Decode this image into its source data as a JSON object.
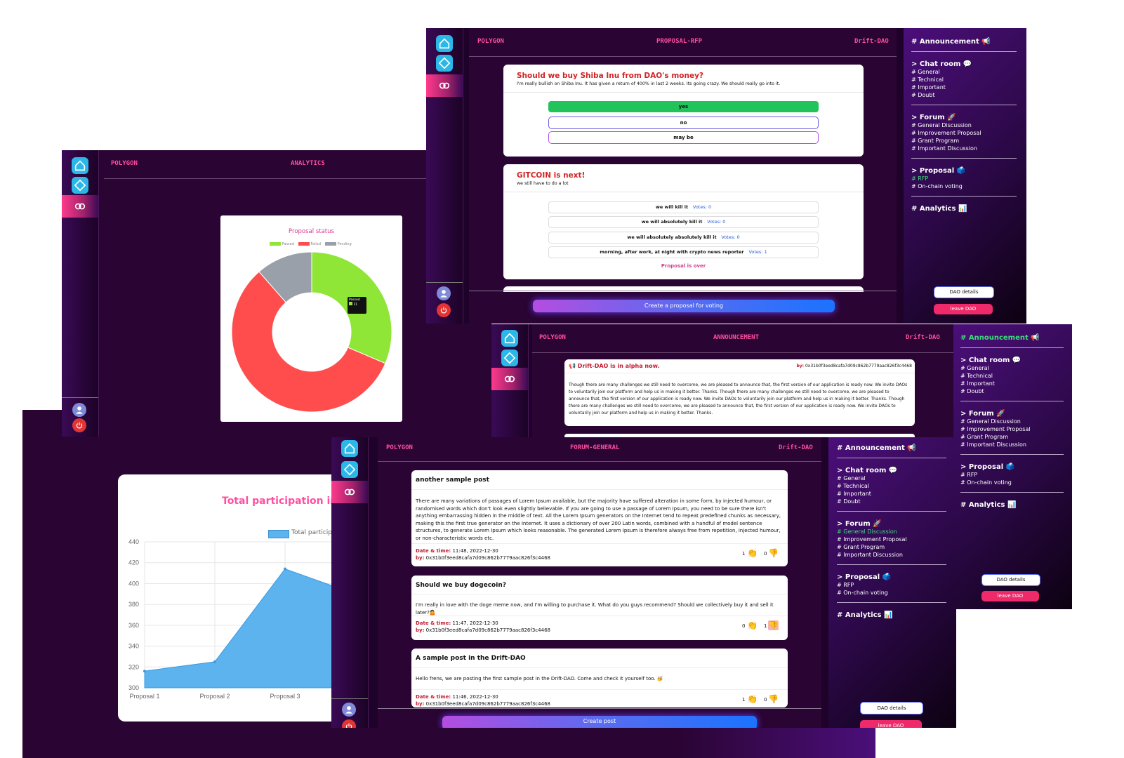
{
  "nav_common": {
    "left": "POLYGON",
    "right": "Drift-DAO"
  },
  "analytics": {
    "center": "ANALYTICS",
    "chart": {
      "title": "Proposal status",
      "tooltip_label": "Passed",
      "tooltip_value": "11"
    }
  },
  "participation": {
    "title": "Total participation in d",
    "legend": "Total participat"
  },
  "rfp": {
    "center": "PROPOSAL-RFP",
    "card1": {
      "title": "Should we buy Shiba Inu from DAO's money?",
      "desc": "I'm really bullish on Shiba Inu. It has given a return of 400% in last 2 weeks. Its going crazy. We should really go into it.",
      "options": [
        "yes",
        "no",
        "may be"
      ]
    },
    "card2": {
      "title": "GITCOIN is next!",
      "desc": "we still have to do a lot",
      "votes_label": "Votes:",
      "options": [
        {
          "label": "we will kill it",
          "votes": "0"
        },
        {
          "label": "we will absolutely kill it",
          "votes": "0"
        },
        {
          "label": "we will absolutely absolutely kill it",
          "votes": "0"
        },
        {
          "label": "morning, after work, at night with crypto news reporter",
          "votes": "1"
        }
      ],
      "over": "Proposal is over"
    },
    "create_btn": "Create a proposal for voting"
  },
  "sidebar_menu": {
    "announcement": "# Announcement 📢",
    "chat": "> Chat room 💬",
    "chat_items": [
      "# General",
      "# Technical",
      "# Important",
      "# Doubt"
    ],
    "forum": "> Forum 🚀",
    "forum_items": [
      "# General Discussion",
      "# Improvement Proposal",
      "# Grant Program",
      "# Important Discussion"
    ],
    "proposal": "> Proposal 🗳️",
    "proposal_items": [
      "# RFP",
      "# On-chain voting"
    ],
    "analytics": "# Analytics 📊",
    "dao_details": "DAO details",
    "leave": "leave DAO"
  },
  "announcement": {
    "center": "ANNOUNCEMENT",
    "title": "📢 Drift-DAO is in alpha now.",
    "by_label": "by:",
    "by": "0x31b0f3eed8cafa7d09c862b7779aac826f3c4468",
    "body": "Though there are many challenges we still need to overcome, we are pleased to announce that, the first version of our application is ready now. We invite DAOs to voluntarily join our platform and help us in making it better. Thanks. Though there are many challenges we still need to overcome, we are pleased to announce that, the first version of our application is ready now. We invite DAOs to voluntarily join our platform and help us in making it better. Thanks. Though there are many challenges we still need to overcome, we are pleased to announce that, the first version of our application is ready now. We invite DAOs to voluntarily join our platform and help us in making it better. Thanks."
  },
  "forum": {
    "center": "FORUM-GENERAL",
    "date_label": "Date & time:",
    "by_label": "by:",
    "posts": [
      {
        "title": "another sample post",
        "body": "There are many variations of passages of Lorem Ipsum available, but the majority have suffered alteration in some form, by injected humour, or randomised words which don't look even slightly believable. If you are going to use a passage of Lorem Ipsum, you need to be sure there isn't anything embarrassing hidden in the middle of text. All the Lorem Ipsum generators on the Internet tend to repeat predefined chunks as necessary, making this the first true generator on the Internet. It uses a dictionary of over 200 Latin words, combined with a handful of model sentence structures, to generate Lorem Ipsum which looks reasonable. The generated Lorem Ipsum is therefore always free from repetition, injected humour, or non-characteristic words etc.",
        "date": "11:48, 2022-12-30",
        "by": "0x31b0f3eed8cafa7d09c862b7779aac826f3c4468",
        "likes": "1",
        "dislikes": "0"
      },
      {
        "title": "Should we buy dogecoin?",
        "body": "I'm really in love with the doge meme now, and I'm willing to purchase it. What do you guys recommend? Should we collectively buy it and sell it later?🤷",
        "date": "11:47, 2022-12-30",
        "by": "0x31b0f3eed8cafa7d09c862b7779aac826f3c4468",
        "likes": "0",
        "dislikes": "1"
      },
      {
        "title": "A sample post in the Drift-DAO",
        "body": "Hello frens, we are posting the first sample post in the Drift-DAO. Come and check it yourself too. 🥳",
        "date": "11:46, 2022-12-30",
        "by": "0x31b0f3eed8cafa7d09c862b7779aac826f3c4468",
        "likes": "1",
        "dislikes": "0"
      }
    ],
    "create_btn": "Create post"
  },
  "chart_data": [
    {
      "type": "pie",
      "title": "Proposal status",
      "categories": [
        "Passed",
        "Failed",
        "Pending"
      ],
      "values": [
        11,
        20,
        4
      ],
      "colors": [
        "#8fe637",
        "#ff4d4d",
        "#9aa0aa"
      ],
      "donut": true,
      "legend": "top"
    },
    {
      "type": "area",
      "title": "Total participation in d",
      "series": [
        {
          "name": "Total participat",
          "values": [
            316,
            325,
            414,
            390
          ]
        }
      ],
      "categories": [
        "Proposal 1",
        "Proposal 2",
        "Proposal 3",
        ""
      ],
      "ylim": [
        300,
        440
      ],
      "yticks": [
        300,
        320,
        340,
        360,
        380,
        400,
        420,
        440
      ],
      "grid": true,
      "color": "#5cb3ee"
    }
  ]
}
